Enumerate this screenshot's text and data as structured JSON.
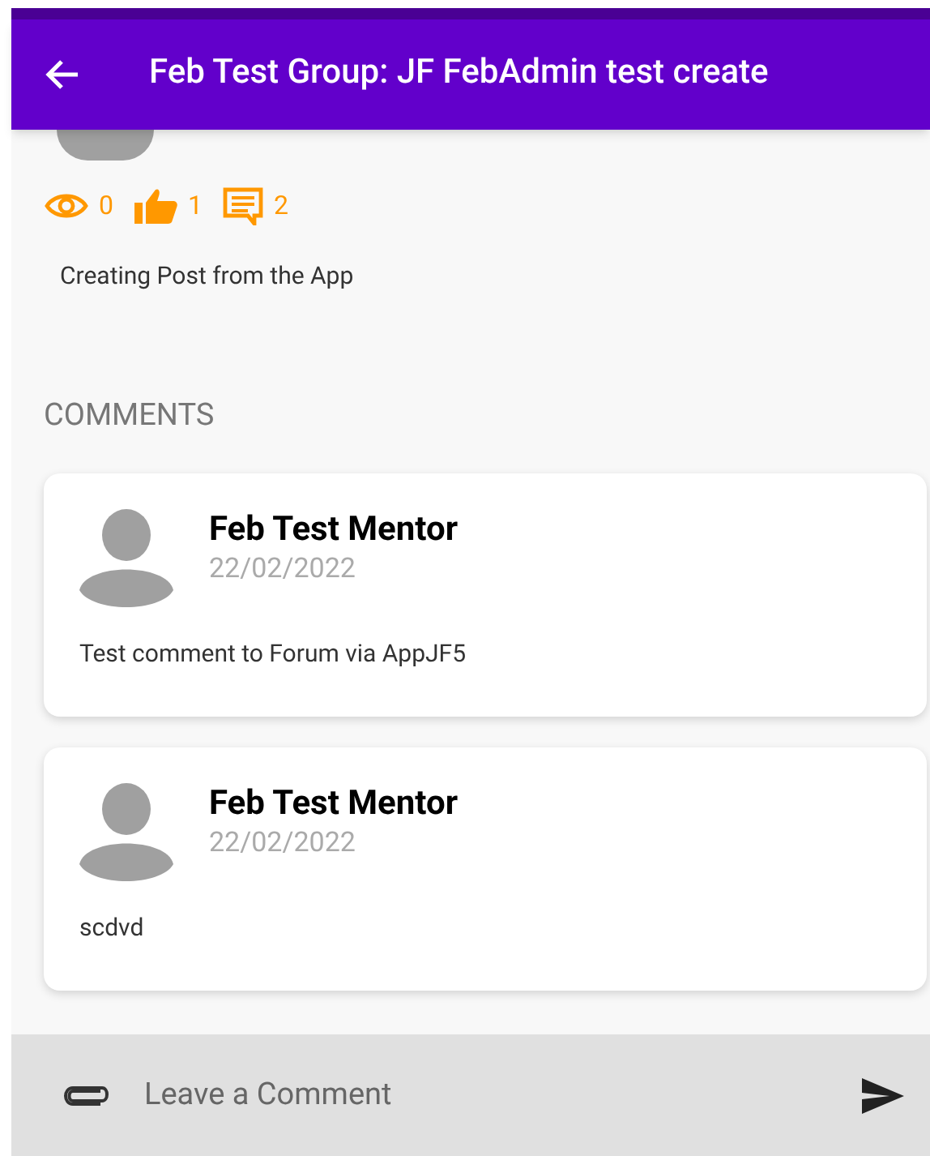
{
  "app_bar": {
    "title": "Feb Test Group: JF FebAdmin test create"
  },
  "post": {
    "stats": [
      {
        "kind": "views",
        "count": "0"
      },
      {
        "kind": "likes",
        "count": "1"
      },
      {
        "kind": "comments",
        "count": "2"
      }
    ],
    "body": "Creating Post from the App"
  },
  "comments_heading": "COMMENTS",
  "comments": [
    {
      "author": "Feb Test Mentor",
      "date": "22/02/2022",
      "text": "Test comment to Forum via AppJF5"
    },
    {
      "author": "Feb Test Mentor",
      "date": "22/02/2022",
      "text": "scdvd"
    }
  ],
  "composer": {
    "placeholder": "Leave a Comment"
  }
}
